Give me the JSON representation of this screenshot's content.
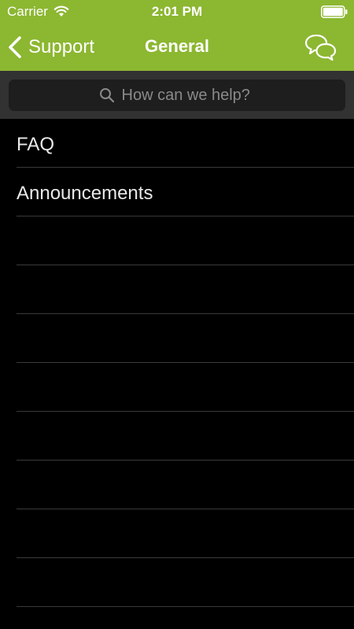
{
  "status_bar": {
    "carrier": "Carrier",
    "time": "2:01 PM",
    "icons": [
      "wifi-icon",
      "battery-icon"
    ]
  },
  "nav": {
    "back_label": "Support",
    "title": "General",
    "back_icon": "chevron-left-icon",
    "action_icon": "chat-bubbles-icon"
  },
  "search": {
    "placeholder": "How can we help?",
    "value": "",
    "icon": "search-icon"
  },
  "list": {
    "items": [
      {
        "label": "FAQ"
      },
      {
        "label": "Announcements"
      }
    ]
  },
  "colors": {
    "header": "#8cb731",
    "search_area": "#323232",
    "search_field": "#1e1e1e",
    "background": "#000000",
    "row_text": "#e9e9e9",
    "separator": "#3a3a3a"
  }
}
